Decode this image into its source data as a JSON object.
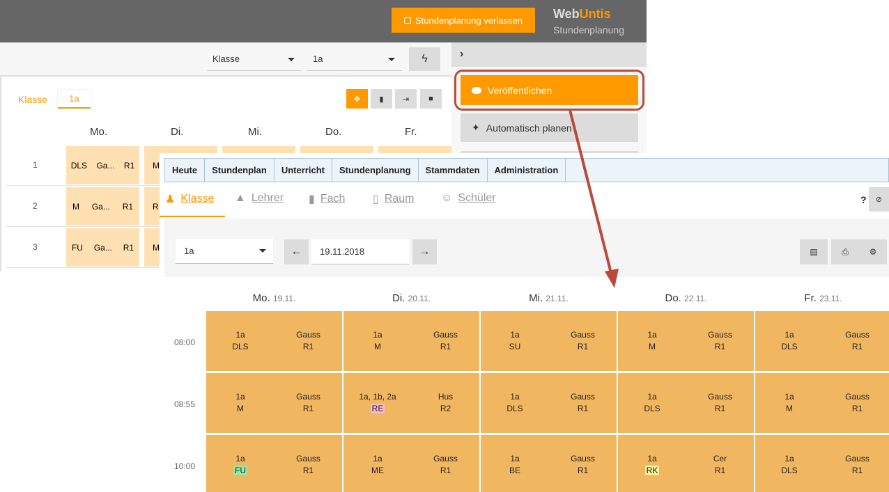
{
  "topbar": {
    "leave_label": "Stundenplanung verlassen",
    "brand_web": "Web",
    "brand_untis": "Untis",
    "brand_sub": "Stundenplanung"
  },
  "toolbar": {
    "klasse_select": "Klasse",
    "class_select": "1a"
  },
  "side": {
    "publish_label": "Veröffentlichen",
    "auto_label": "Automatisch planen"
  },
  "bg_timetable": {
    "tab_label": "Klasse",
    "tab_value": "1a",
    "days": [
      "Mo.",
      "Di.",
      "Mi.",
      "Do.",
      "Fr."
    ],
    "rows": [
      {
        "num": "1",
        "mo": [
          "DLS",
          "Ga...",
          "R1"
        ],
        "di_first": "M"
      },
      {
        "num": "2",
        "mo": [
          "M",
          "Ga...",
          "R1"
        ],
        "di_first": "R"
      },
      {
        "num": "3",
        "mo": [
          "FU",
          "Ga...",
          "R1"
        ],
        "di_first": "M"
      }
    ]
  },
  "nav": {
    "items": [
      "Heute",
      "Stundenplan",
      "Unterricht",
      "Stundenplanung",
      "Stammdaten",
      "Administration"
    ]
  },
  "tabs": {
    "klasse": "Klasse",
    "lehrer": "Lehrer",
    "fach": "Fach",
    "raum": "Raum",
    "schueler": "Schüler",
    "help": "?"
  },
  "filter": {
    "class_value": "1a",
    "date_value": "19.11.2018"
  },
  "timetable": {
    "days": [
      {
        "name": "Mo.",
        "date": "19.11."
      },
      {
        "name": "Di.",
        "date": "20.11."
      },
      {
        "name": "Mi.",
        "date": "21.11."
      },
      {
        "name": "Do.",
        "date": "22.11."
      },
      {
        "name": "Fr.",
        "date": "23.11."
      }
    ],
    "times": [
      "08:00",
      "08:55",
      "10:00"
    ],
    "lessons": [
      [
        {
          "class": "1a",
          "subject": "DLS",
          "teacher": "Gauss",
          "room": "R1"
        },
        {
          "class": "1a",
          "subject": "M",
          "teacher": "Gauss",
          "room": "R1"
        },
        {
          "class": "1a",
          "subject": "SU",
          "teacher": "Gauss",
          "room": "R1"
        },
        {
          "class": "1a",
          "subject": "M",
          "teacher": "Gauss",
          "room": "R1"
        },
        {
          "class": "1a",
          "subject": "DLS",
          "teacher": "Gauss",
          "room": "R1"
        }
      ],
      [
        {
          "class": "1a",
          "subject": "M",
          "teacher": "Gauss",
          "room": "R1"
        },
        {
          "class": "1a, 1b, 2a",
          "subject": "RE",
          "teacher": "Hus",
          "room": "R2",
          "highlight": "pink"
        },
        {
          "class": "1a",
          "subject": "DLS",
          "teacher": "Gauss",
          "room": "R1"
        },
        {
          "class": "1a",
          "subject": "DLS",
          "teacher": "Gauss",
          "room": "R1"
        },
        {
          "class": "1a",
          "subject": "M",
          "teacher": "Gauss",
          "room": "R1"
        }
      ],
      [
        {
          "class": "1a",
          "subject": "FU",
          "teacher": "Gauss",
          "room": "R1",
          "highlight": "green"
        },
        {
          "class": "1a",
          "subject": "ME",
          "teacher": "Gauss",
          "room": "R1"
        },
        {
          "class": "1a",
          "subject": "BE",
          "teacher": "Gauss",
          "room": "R1"
        },
        {
          "class": "1a",
          "subject": "RK",
          "teacher": "Cer",
          "room": "R1",
          "highlight": "yellow"
        },
        {
          "class": "1a",
          "subject": "DLS",
          "teacher": "Gauss",
          "room": "R1"
        }
      ]
    ]
  },
  "colors": {
    "accent": "#ff9900",
    "lesson": "#f0b660",
    "annotation": "#b94a3c"
  }
}
